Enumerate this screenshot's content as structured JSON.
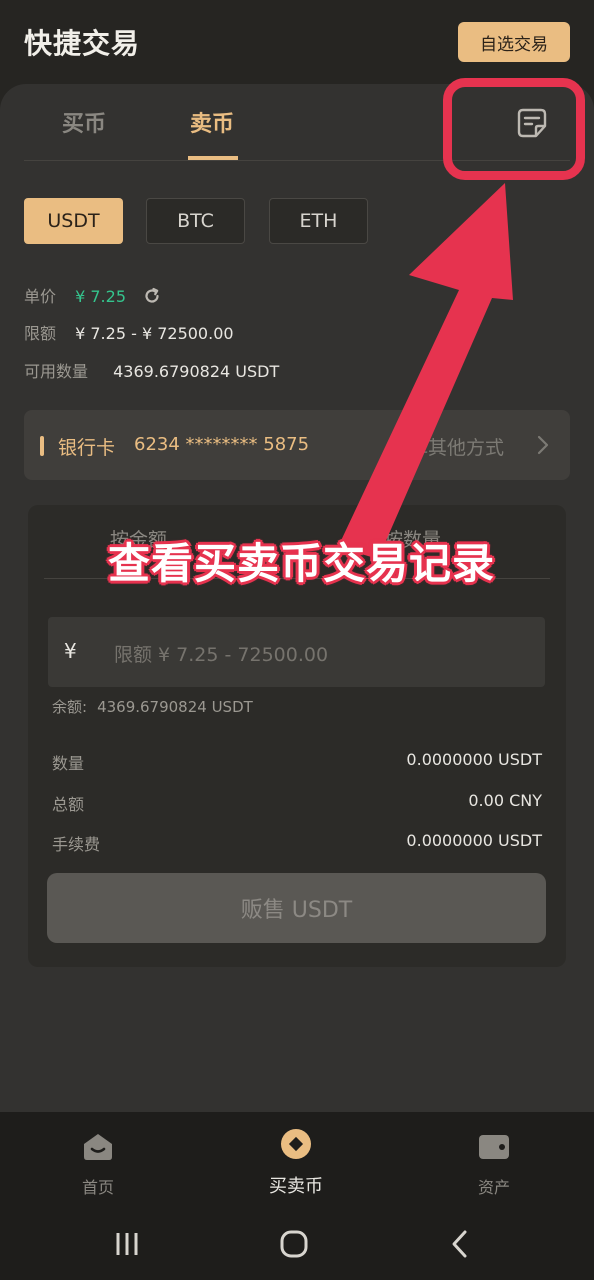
{
  "header": {
    "title": "快捷交易",
    "favorite_button": "自选交易"
  },
  "tabs": {
    "buy": "买币",
    "sell": "卖币",
    "active": "sell"
  },
  "coins": [
    {
      "label": "USDT",
      "active": true
    },
    {
      "label": "BTC",
      "active": false
    },
    {
      "label": "ETH",
      "active": false
    }
  ],
  "info": {
    "price_label": "单价",
    "price_value": "¥ 7.25",
    "limit_label": "限额",
    "limit_value": "¥ 7.25 - ¥ 72500.00",
    "available_label": "可用数量",
    "available_value": "4369.6790824 USDT"
  },
  "payment": {
    "method_label": "银行卡",
    "card_number": "6234 ******** 5875",
    "other_label": "选择其他方式"
  },
  "panel": {
    "tab_amount": "按金额",
    "tab_quantity": "按数量",
    "currency_symbol": "¥",
    "amount_placeholder": "限额   ¥ 7.25 - 72500.00",
    "balance_label": "余额:",
    "balance_value": "4369.6790824 USDT",
    "quantity_label": "数量",
    "quantity_value": "0.0000000 USDT",
    "total_label": "总额",
    "total_value": "0.00 CNY",
    "fee_label": "手续费",
    "fee_value": "0.0000000 USDT",
    "sell_button": "贩售 USDT"
  },
  "annotation": {
    "caption": "查看买卖币交易记录"
  },
  "bottom_nav": [
    {
      "label": "首页",
      "icon": "home-icon",
      "active": false
    },
    {
      "label": "买卖币",
      "icon": "trade-icon",
      "active": true
    },
    {
      "label": "资产",
      "icon": "wallet-icon",
      "active": false
    }
  ],
  "colors": {
    "accent": "#eabd82",
    "price_green": "#34c48d",
    "annotation_red": "#e6334f",
    "background": "#262522"
  }
}
